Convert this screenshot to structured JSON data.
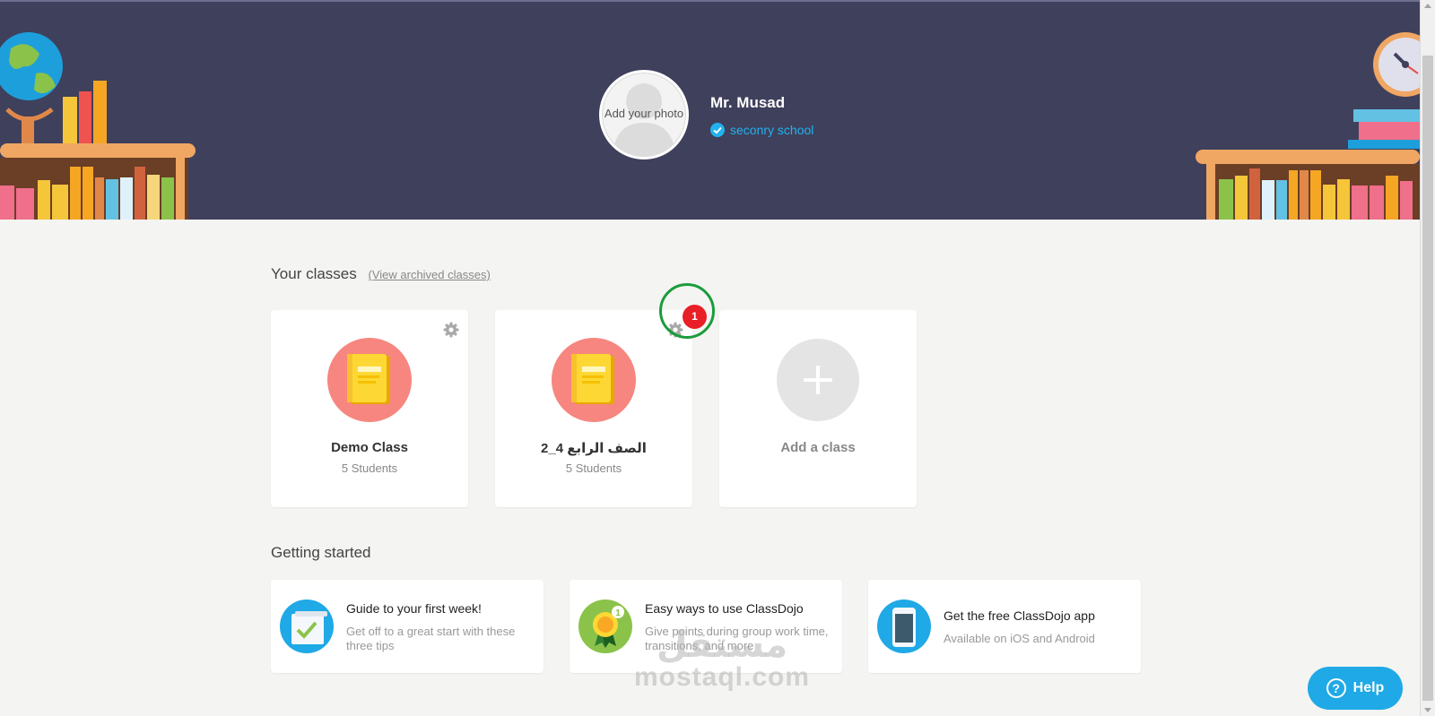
{
  "profile": {
    "photo_label": "Add your photo",
    "teacher_name": "Mr. Musad",
    "school": "seconry school"
  },
  "classes_section": {
    "title": "Your classes",
    "archived_link": "(View archived classes)",
    "classes": [
      {
        "name": "Demo Class",
        "students": "5 Students"
      },
      {
        "name": "الصف الرابع 4_2",
        "students": "5 Students"
      }
    ],
    "add_class_label": "Add a class",
    "notification_count": "1"
  },
  "getting_started": {
    "title": "Getting started",
    "cards": [
      {
        "title": "Guide to your first week!",
        "desc": "Get off to a great start with these three tips"
      },
      {
        "title": "Easy ways to use ClassDojo",
        "desc": "Give points during group work time, transitions, and more"
      },
      {
        "title": "Get the free ClassDojo app",
        "desc": "Available on iOS and Android"
      }
    ]
  },
  "help": {
    "label": "Help"
  },
  "watermark": {
    "arabic": "مستقل",
    "latin": "mostaql.com"
  },
  "colors": {
    "header_bg": "#3f405c",
    "class_circle": "#f6867f",
    "accent_blue": "#1fa9e6",
    "notification_red": "#e81f26",
    "highlight_green": "#1a9c3c"
  }
}
